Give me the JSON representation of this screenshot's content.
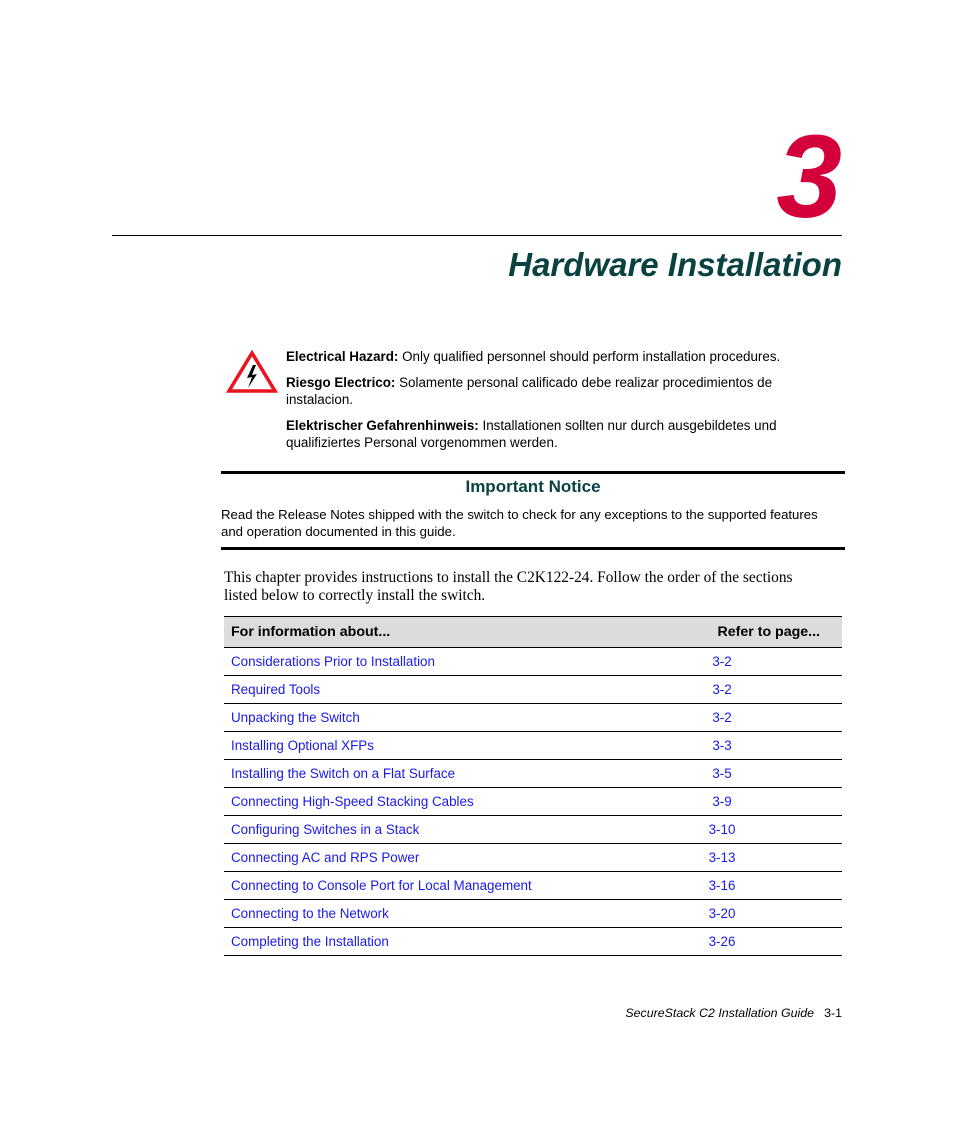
{
  "chapter": {
    "number": "3",
    "title": "Hardware Installation",
    "number_color": "#d4003b",
    "title_color": "#0a4242"
  },
  "hazard": {
    "icon": "electrical-hazard-icon",
    "items": [
      {
        "label": "Electrical Hazard:",
        "text": " Only qualified personnel should perform installation procedures."
      },
      {
        "label": "Riesgo Electrico:",
        "text": " Solamente personal calificado debe realizar procedimientos de instalacion."
      },
      {
        "label": "Elektrischer Gefahrenhinweis:",
        "text": " Installationen sollten nur durch ausgebildetes und qualifiziertes Personal vorgenommen werden."
      }
    ]
  },
  "notice": {
    "title": "Important Notice",
    "body": "Read the Release Notes shipped with the switch to check for any exceptions to the supported features and operation documented in this guide."
  },
  "intro": "This chapter provides instructions to install the C2K122-24. Follow the order of the sections listed below to correctly install the switch.",
  "toc": {
    "headers": [
      "For information about...",
      "Refer to page..."
    ],
    "link_color": "#1a1ae6",
    "rows": [
      {
        "topic": "Considerations Prior to Installation",
        "page": "3-2"
      },
      {
        "topic": "Required Tools",
        "page": "3-2"
      },
      {
        "topic": "Unpacking the Switch",
        "page": "3-2"
      },
      {
        "topic": "Installing Optional XFPs",
        "page": "3-3"
      },
      {
        "topic": "Installing the Switch on a Flat Surface",
        "page": "3-5"
      },
      {
        "topic": "Connecting High-Speed Stacking Cables",
        "page": "3-9"
      },
      {
        "topic": "Configuring Switches in a Stack",
        "page": "3-10"
      },
      {
        "topic": "Connecting AC and RPS Power",
        "page": "3-13"
      },
      {
        "topic": "Connecting to Console Port for Local Management",
        "page": "3-16"
      },
      {
        "topic": "Connecting to the Network",
        "page": "3-20"
      },
      {
        "topic": "Completing the Installation",
        "page": "3-26"
      }
    ]
  },
  "footer": {
    "guide": "SecureStack C2 Installation Guide",
    "page": "3-1"
  }
}
